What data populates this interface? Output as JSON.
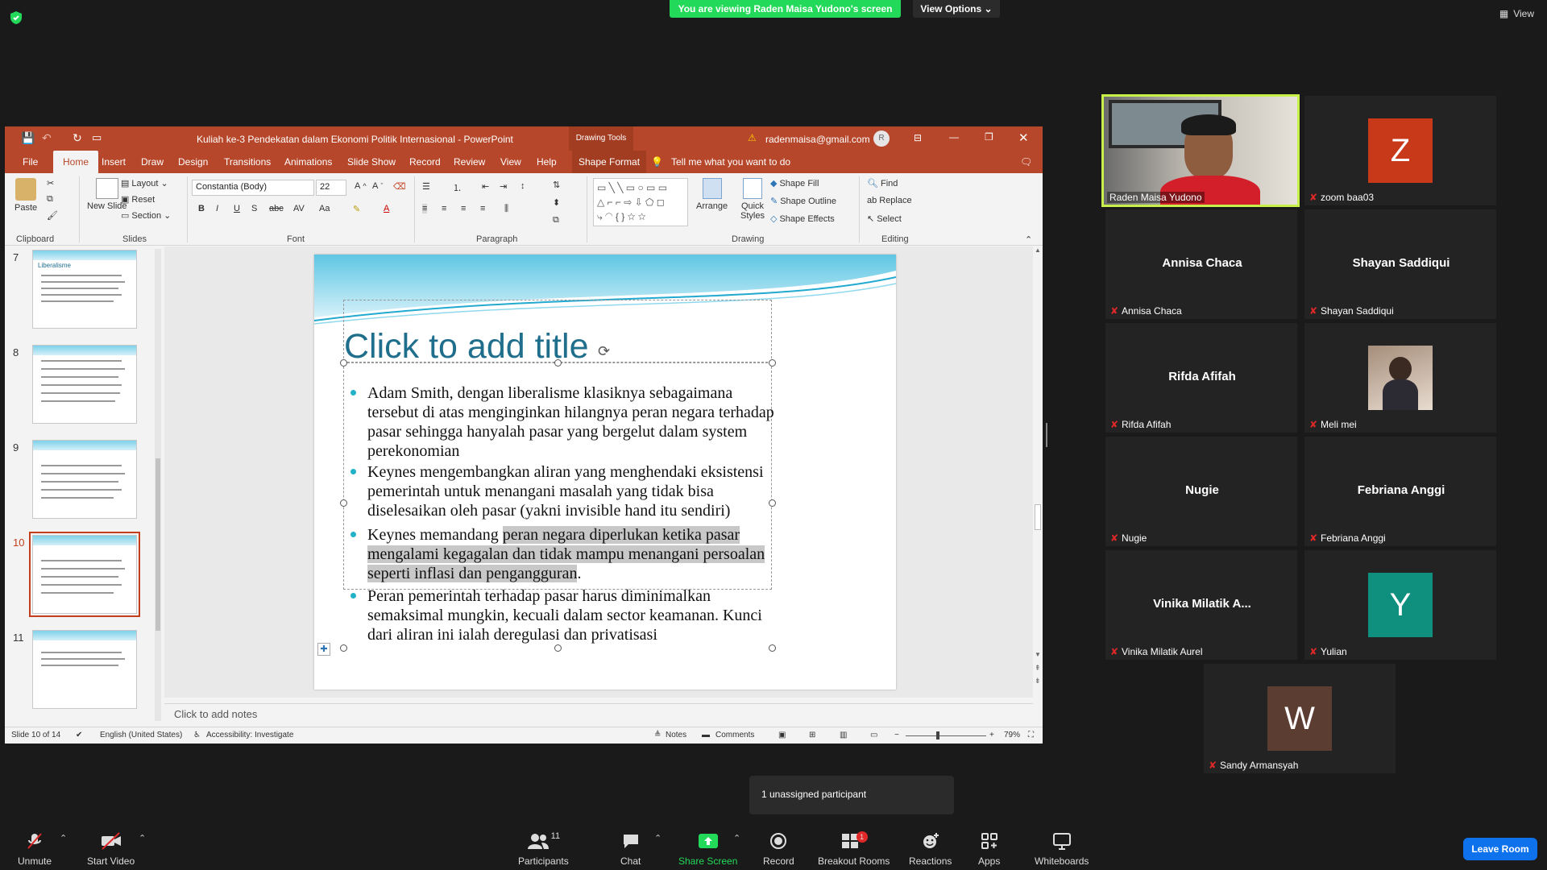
{
  "zoom": {
    "viewing_banner": "You are viewing Raden Maisa Yudono's screen",
    "view_options": "View Options",
    "view_label": "View",
    "unassigned": "1 unassigned participant",
    "leave": "Leave Room",
    "toolbar": {
      "unmute": "Unmute",
      "start_video": "Start Video",
      "participants": "Participants",
      "participants_count": "11",
      "chat": "Chat",
      "share_screen": "Share Screen",
      "record": "Record",
      "breakout_rooms": "Breakout Rooms",
      "breakout_badge": "1",
      "reactions": "Reactions",
      "apps": "Apps",
      "whiteboards": "Whiteboards"
    },
    "participants": [
      {
        "name": "Raden Maisa Yudono"
      },
      {
        "name": "zoom baa03",
        "initial": "Z",
        "color": "#c8391a"
      },
      {
        "name": "Annisa Chaca"
      },
      {
        "name": "Shayan Saddiqui"
      },
      {
        "name": "Rifda Afifah"
      },
      {
        "name": "Meli mei"
      },
      {
        "name": "Nugie"
      },
      {
        "name": "Febriana Anggi"
      },
      {
        "name": "Vinika Milatik Aurel",
        "short": "Vinika Milatik A..."
      },
      {
        "name": "Yulian",
        "initial": "Y",
        "color": "#0f8f7e"
      },
      {
        "name": "Sandy Armansyah",
        "initial": "W",
        "color": "#5b3d32"
      }
    ]
  },
  "ppt": {
    "title": "Kuliah ke-3 Pendekatan dalam Ekonomi Politik Internasional  -  PowerPoint",
    "drawing_tools": "Drawing Tools",
    "account": "radenmaisa@gmail.com",
    "account_initial": "R",
    "tabs": [
      "File",
      "Home",
      "Insert",
      "Draw",
      "Design",
      "Transitions",
      "Animations",
      "Slide Show",
      "Record",
      "Review",
      "View",
      "Help",
      "Shape Format"
    ],
    "tell_me": "Tell me what you want to do",
    "ribbon": {
      "paste": "Paste",
      "new_slide": "New Slide",
      "layout": "Layout",
      "reset": "Reset",
      "section": "Section",
      "font_name": "Constantia (Body)",
      "font_size": "22",
      "arrange": "Arrange",
      "quick_styles": "Quick Styles",
      "shape_fill": "Shape Fill",
      "shape_outline": "Shape Outline",
      "shape_effects": "Shape Effects",
      "find": "Find",
      "replace": "Replace",
      "select": "Select",
      "groups": [
        "Clipboard",
        "Slides",
        "Font",
        "Paragraph",
        "Drawing",
        "Editing"
      ]
    },
    "thumbnails": [
      {
        "num": "7",
        "title": "Liberalisme"
      },
      {
        "num": "8",
        "title": ""
      },
      {
        "num": "9",
        "title": ""
      },
      {
        "num": "10",
        "title": ""
      },
      {
        "num": "11",
        "title": ""
      }
    ],
    "slide": {
      "title_placeholder": "Click to add title",
      "bullets": [
        {
          "lines": [
            "Adam Smith, dengan liberalisme klasiknya sebagaimana",
            "tersebut di atas menginginkan hilangnya peran negara terhadap",
            "pasar sehingga hanyalah pasar yang bergelut dalam system",
            "perekonomian"
          ]
        },
        {
          "lines": [
            "Keynes mengembangkan aliran yang menghendaki eksistensi",
            "pemerintah untuk menangani masalah yang tidak bisa",
            "diselesaikan oleh pasar (yakni invisible hand itu sendiri)"
          ]
        },
        {
          "lines": [
            "Keynes memandang peran negara diperlukan ketika pasar",
            "mengalami kegagalan dan tidak mampu menangani persoalan",
            "seperti inflasi dan pengangguran."
          ]
        },
        {
          "lines": [
            "Peran pemerintah terhadap pasar harus diminimalkan",
            "semaksimal mungkin, kecuali dalam sector keamanan. Kunci",
            "dari aliran ini ialah deregulasi dan privatisasi"
          ]
        }
      ],
      "highlight_prefix": "Keynes memandang ",
      "highlight_1": "peran negara diperlukan ketika pasar",
      "highlight_2": "mengalami kegagalan dan tidak mampu menangani persoalan",
      "highlight_3": "seperti inflasi dan pengangguran",
      "highlight_3_tail": "."
    },
    "notes_placeholder": "Click to add notes",
    "status": {
      "slide": "Slide 10 of 14",
      "language": "English (United States)",
      "accessibility": "Accessibility: Investigate",
      "notes": "Notes",
      "comments": "Comments",
      "zoom": "79%"
    }
  }
}
